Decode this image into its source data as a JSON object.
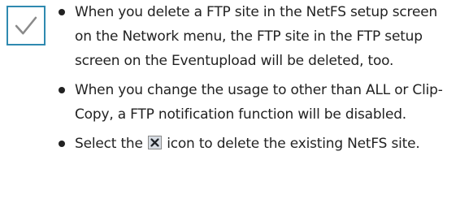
{
  "note": {
    "icon": "checkmark-icon",
    "border_color": "#2f8ab0",
    "check_color": "#8a8a8a"
  },
  "bullets": [
    {
      "text": "When you delete a FTP site in the NetFS setup screen on the Network menu, the FTP site in the FTP setup screen on the Eventupload will be deleted, too."
    },
    {
      "text": "When you change the usage to other than ALL or Clip-Copy, a FTP notification function will be disabled."
    },
    {
      "before_icon": "Select the",
      "icon": "close-icon",
      "after_icon": "icon to delete the existing NetFS site."
    }
  ]
}
